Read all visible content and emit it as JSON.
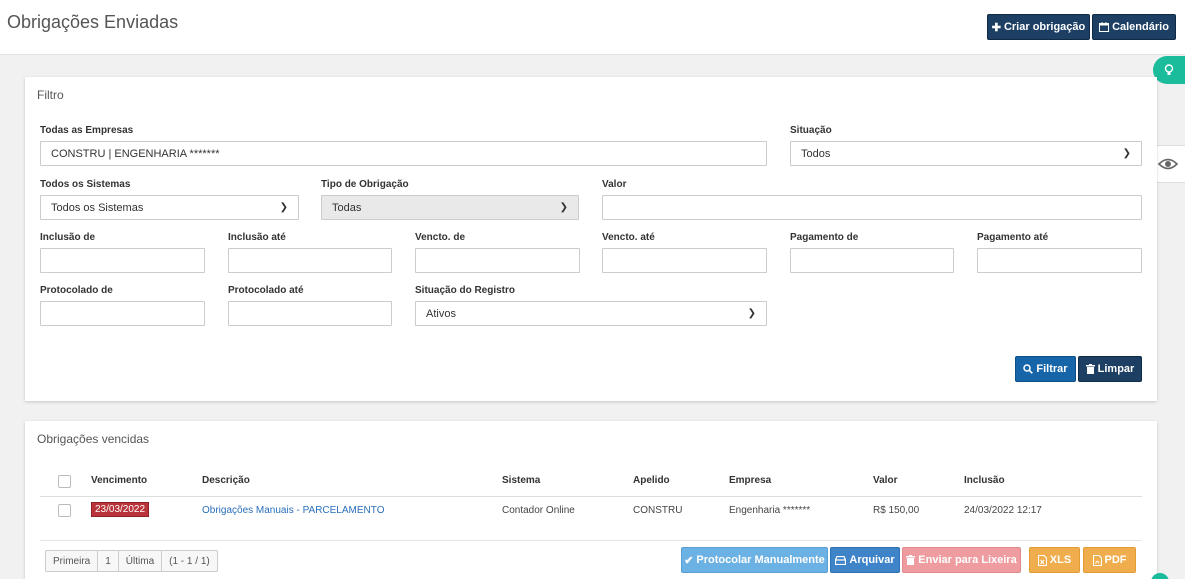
{
  "header": {
    "title": "Obrigações Enviadas",
    "create_label": "Criar obrigação",
    "calendar_label": "Calendário"
  },
  "filter": {
    "title": "Filtro",
    "empresas_label": "Todas as Empresas",
    "empresas_value": "CONSTRU | ENGENHARIA *******",
    "situacao_label": "Situação",
    "situacao_value": "Todos",
    "sistemas_label": "Todos os Sistemas",
    "sistemas_value": "Todos os Sistemas",
    "tipo_label": "Tipo de Obrigação",
    "tipo_value": "Todas",
    "valor_label": "Valor",
    "valor_value": "",
    "inclusao_de_label": "Inclusão de",
    "inclusao_ate_label": "Inclusão até",
    "vencto_de_label": "Vencto. de",
    "vencto_ate_label": "Vencto. até",
    "pagamento_de_label": "Pagamento de",
    "pagamento_ate_label": "Pagamento até",
    "protocolado_de_label": "Protocolado de",
    "protocolado_ate_label": "Protocolado até",
    "situacao_registro_label": "Situação do Registro",
    "situacao_registro_value": "Ativos",
    "filtrar_label": "Filtrar",
    "limpar_label": "Limpar"
  },
  "list": {
    "title": "Obrigações vencidas",
    "columns": [
      "Vencimento",
      "Descrição",
      "Sistema",
      "Apelido",
      "Empresa",
      "Valor",
      "Inclusão"
    ],
    "rows": [
      {
        "vencimento": "23/03/2022",
        "descricao": "Obrigações Manuais - PARCELAMENTO",
        "sistema": "Contador Online",
        "apelido": "CONSTRU",
        "empresa": "Engenharia *******",
        "valor": "R$ 150,00",
        "inclusao": "24/03/2022 12:17"
      }
    ],
    "pager": {
      "first": "Primeira",
      "page": "1",
      "last": "Última",
      "range": "(1 - 1 / 1)"
    },
    "actions": {
      "protocolar": "Protocolar Manualmente",
      "arquivar": "Arquivar",
      "lixeira": "Enviar para Lixeira",
      "xls": "XLS",
      "pdf": "PDF"
    }
  },
  "colors": {
    "navy": "#1c3f63",
    "blue": "#1565a8",
    "teal": "#1abc9c",
    "overdue": "#b8343a",
    "orange": "#f0ad4e"
  }
}
